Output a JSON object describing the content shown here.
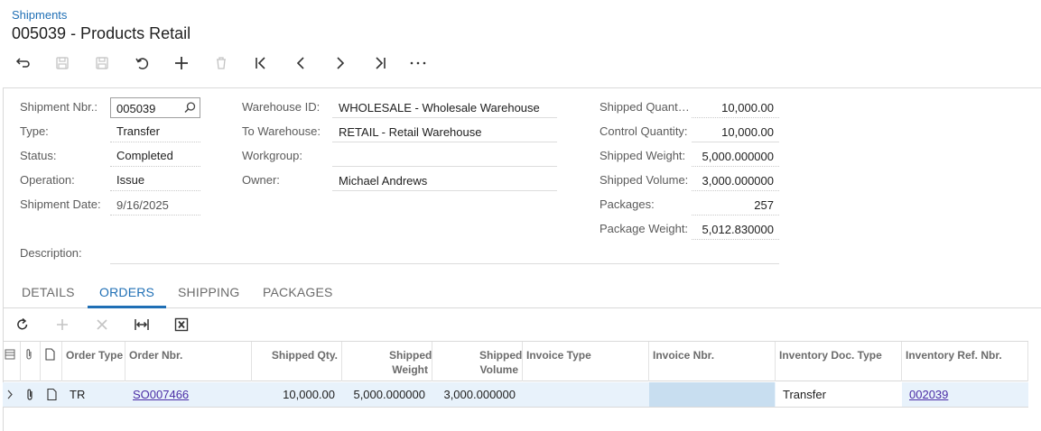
{
  "breadcrumb": "Shipments",
  "title": "005039 - Products Retail",
  "toolbar": {
    "icons": [
      "back-arrow-icon",
      "save-close-icon",
      "save-icon",
      "undo-icon",
      "plus-icon",
      "trash-icon",
      "first-record-icon",
      "prev-record-icon",
      "next-record-icon",
      "last-record-icon",
      "more-icon"
    ]
  },
  "form": {
    "shipment_nbr": {
      "label": "Shipment Nbr.:",
      "value": "005039"
    },
    "type": {
      "label": "Type:",
      "value": "Transfer"
    },
    "status": {
      "label": "Status:",
      "value": "Completed"
    },
    "operation": {
      "label": "Operation:",
      "value": "Issue"
    },
    "shipment_date": {
      "label": "Shipment Date:",
      "value": "9/16/2025"
    },
    "description": {
      "label": "Description:",
      "value": ""
    },
    "warehouse_id": {
      "label": "Warehouse ID:",
      "value": "WHOLESALE - Wholesale Warehouse"
    },
    "to_warehouse": {
      "label": "To Warehouse:",
      "value": "RETAIL - Retail Warehouse"
    },
    "workgroup": {
      "label": "Workgroup:",
      "value": ""
    },
    "owner": {
      "label": "Owner:",
      "value": "Michael Andrews"
    },
    "shipped_quantity": {
      "label": "Shipped Quant…",
      "value": "10,000.00"
    },
    "control_quantity": {
      "label": "Control Quantity:",
      "value": "10,000.00"
    },
    "shipped_weight": {
      "label": "Shipped Weight:",
      "value": "5,000.000000"
    },
    "shipped_volume": {
      "label": "Shipped Volume:",
      "value": "3,000.000000"
    },
    "packages": {
      "label": "Packages:",
      "value": "257"
    },
    "package_weight": {
      "label": "Package Weight:",
      "value": "5,012.830000"
    }
  },
  "tabs": [
    {
      "label": "DETAILS"
    },
    {
      "label": "ORDERS"
    },
    {
      "label": "SHIPPING"
    },
    {
      "label": "PACKAGES"
    }
  ],
  "active_tab": "ORDERS",
  "grid": {
    "columns": {
      "order_type": "Order Type",
      "order_nbr": "Order Nbr.",
      "shipped_qty": "Shipped Qty.",
      "shipped_weight": "Shipped Weight",
      "shipped_volume": "Shipped Volume",
      "invoice_type": "Invoice Type",
      "invoice_nbr": "Invoice Nbr.",
      "inventory_doc_type": "Inventory Doc. Type",
      "inventory_ref_nbr": "Inventory Ref. Nbr."
    },
    "rows": [
      {
        "order_type": "TR",
        "order_nbr": "SO007466",
        "shipped_qty": "10,000.00",
        "shipped_weight": "5,000.000000",
        "shipped_volume": "3,000.000000",
        "invoice_type": "",
        "invoice_nbr": "",
        "inventory_doc_type": "Transfer",
        "inventory_ref_nbr": "002039"
      }
    ]
  },
  "colors": {
    "accent": "#1f6fb5",
    "link": "#4a2da6",
    "row_selected": "#e8f2fb"
  }
}
